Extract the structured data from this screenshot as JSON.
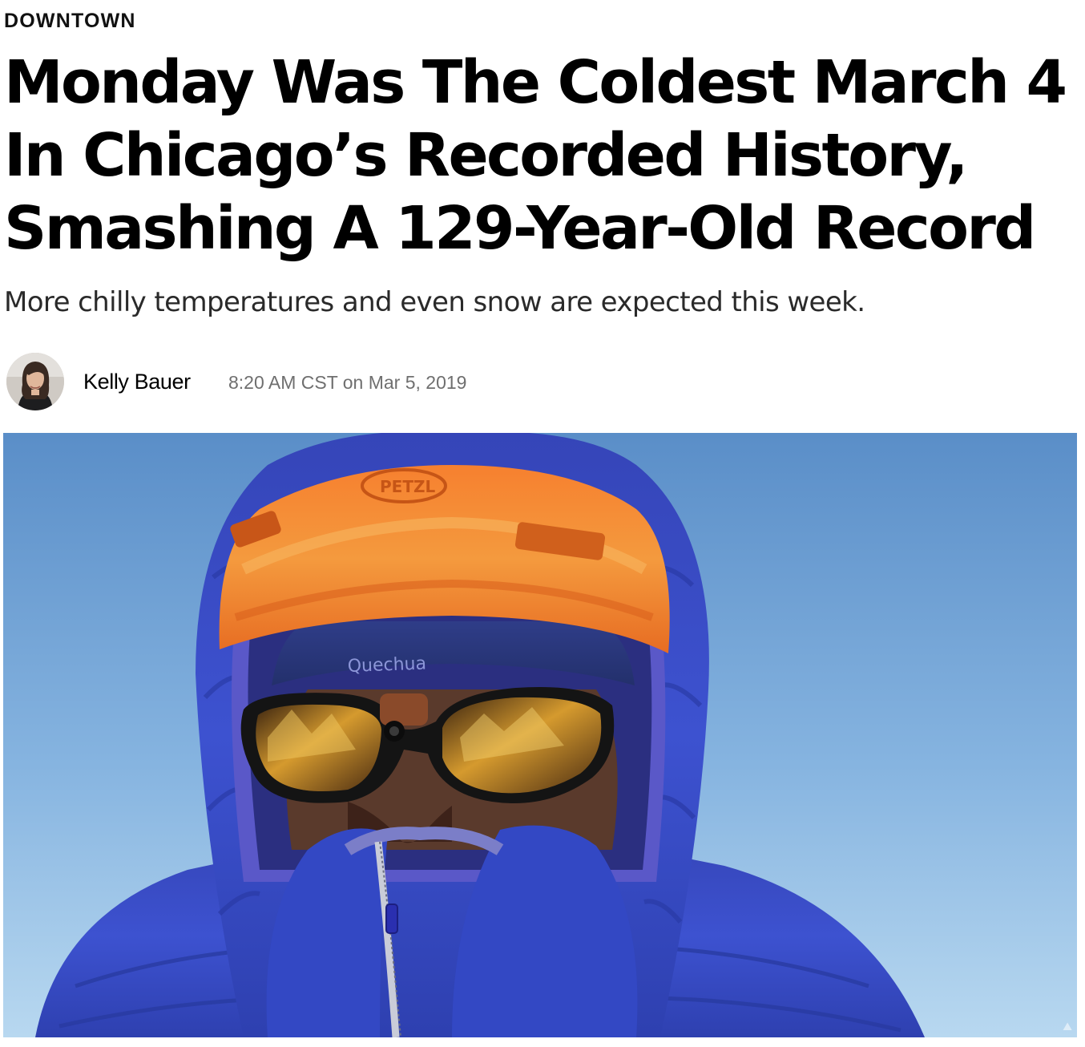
{
  "article": {
    "section": "DOWNTOWN",
    "headline": "Monday Was The Coldest March 4 In Chicago’s Recorded History, Smashing A 129-Year-Old Record",
    "dek": "More chilly temperatures and even snow are expected this week.",
    "author": "Kelly Bauer",
    "timestamp": "8:20 AM CST on Mar 5, 2019"
  },
  "lead_image": {
    "helmet_brand": "PETZL",
    "headband_brand": "Quechua",
    "colors": {
      "sky_top": "#5b8fc9",
      "sky_bottom": "#b5d6ef",
      "jacket": "#3d4fc9",
      "helmet": "#f07a2a"
    }
  }
}
